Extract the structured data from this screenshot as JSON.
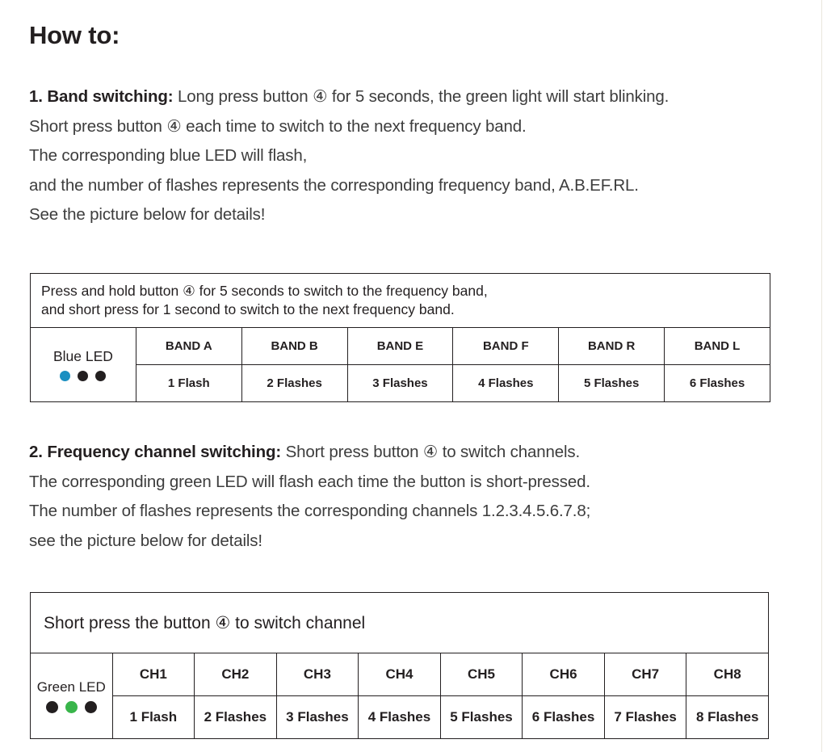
{
  "title": "How to:",
  "colors": {
    "blue_led": "#1a8fc1",
    "green_led": "#39b54a",
    "off_led": "#231f20",
    "text": "#3d3d3d",
    "heading": "#231f20",
    "table_border": "#231f20"
  },
  "paragraphs": [
    {
      "id": "band-switching",
      "lead": "1. Band switching:",
      "lines": [
        " Long press button ④ for 5 seconds, the green light will start blinking.",
        "Short press button ④ each time to switch to the next frequency band.",
        "The corresponding blue LED will flash,",
        "and the number of flashes represents the corresponding frequency band, A.B.EF.RL.",
        "See the picture below for details!"
      ]
    },
    {
      "id": "frequency-channel-switching",
      "lead": "2. Frequency channel switching:",
      "lines": [
        " Short press button ④ to switch channels.",
        "The corresponding green LED will flash each time the button is short-pressed.",
        "The number of flashes represents the corresponding channels  1.2.3.4.5.6.7.8;",
        "see the picture below for details!"
      ]
    }
  ],
  "table_bands": {
    "title_line_1": "Press and hold button ④ for 5 seconds to switch to the frequency band,",
    "title_line_2": "and short press for 1 second to switch to the next frequency band.",
    "led_label": "Blue LED",
    "led_dots": [
      "on",
      "off",
      "off"
    ],
    "led_color": "#1a8fc1",
    "headers": [
      "BAND A",
      "BAND B",
      "BAND E",
      "BAND F",
      "BAND R",
      "BAND L"
    ],
    "values": [
      "1 Flash",
      "2 Flashes",
      "3 Flashes",
      "4 Flashes",
      "5 Flashes",
      "6 Flashes"
    ]
  },
  "table_channels": {
    "title": "Short press the button ④ to switch channel",
    "led_label": "Green LED",
    "led_dots": [
      "off",
      "on",
      "off"
    ],
    "led_color": "#39b54a",
    "headers": [
      "CH1",
      "CH2",
      "CH3",
      "CH4",
      "CH5",
      "CH6",
      "CH7",
      "CH8"
    ],
    "values": [
      "1 Flash",
      "2 Flashes",
      "3 Flashes",
      "4 Flashes",
      "5 Flashes",
      "6 Flashes",
      "7 Flashes",
      "8 Flashes"
    ]
  }
}
